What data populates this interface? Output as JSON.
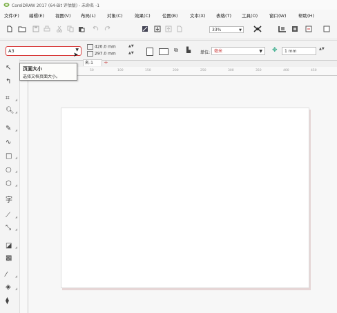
{
  "window": {
    "title": "CorelDRAW 2017 (64-Bit 评估版) - 未命名 -1"
  },
  "menubar": {
    "items": [
      "文件(F)",
      "编辑(E)",
      "视图(V)",
      "布局(L)",
      "对象(C)",
      "效果(C)",
      "位图(B)",
      "文本(X)",
      "表格(T)",
      "工具(O)",
      "窗口(W)",
      "帮助(H)"
    ]
  },
  "toolbar": {
    "zoom_value": "33%"
  },
  "property_bar": {
    "paper_size": "A3",
    "width_value": "420.0 mm",
    "height_value": "297.0 mm",
    "units_label": "单位:",
    "units_value": "毫米",
    "nudge_value": "1 mm"
  },
  "tooltip": {
    "title": "页面大小",
    "description": "选择文档页面大小。"
  },
  "document": {
    "tab_label": "名-1",
    "add_tab": "+"
  },
  "ruler": {
    "ticks": [
      "50",
      "100",
      "150",
      "200",
      "250",
      "300",
      "350",
      "400",
      "450"
    ]
  },
  "colors": {
    "highlight": "#d83a3a",
    "page": "#ffffff",
    "canvas": "#f7f7f7"
  }
}
